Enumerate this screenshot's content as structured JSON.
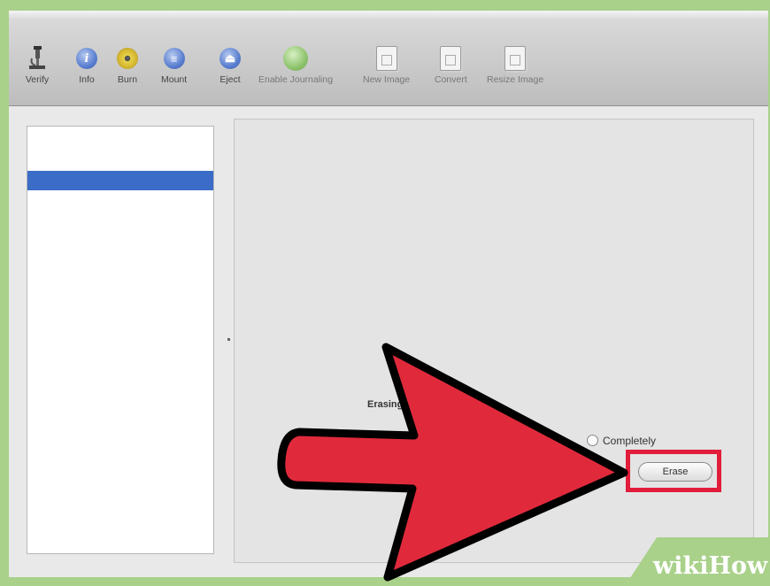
{
  "toolbar": {
    "items": [
      {
        "label": "Verify",
        "icon": "microscope-icon"
      },
      {
        "label": "Info",
        "icon": "info-icon"
      },
      {
        "label": "Burn",
        "icon": "burn-icon"
      },
      {
        "label": "Mount",
        "icon": "mount-icon"
      },
      {
        "label": "Eject",
        "icon": "eject-icon"
      },
      {
        "label": "Enable Journaling",
        "icon": "journaling-icon"
      },
      {
        "label": "New Image",
        "icon": "new-image-icon"
      },
      {
        "label": "Convert",
        "icon": "convert-icon"
      },
      {
        "label": "Resize Image",
        "icon": "resize-image-icon"
      }
    ]
  },
  "panel": {
    "erasing_label": "Erasing",
    "option_label": "Completely",
    "erase_button": "Erase"
  },
  "annotation": {
    "arrow_color": "#e02a3c",
    "highlight_color": "#e21c3b"
  },
  "watermark": {
    "wiki": "wiki",
    "how": "How"
  }
}
